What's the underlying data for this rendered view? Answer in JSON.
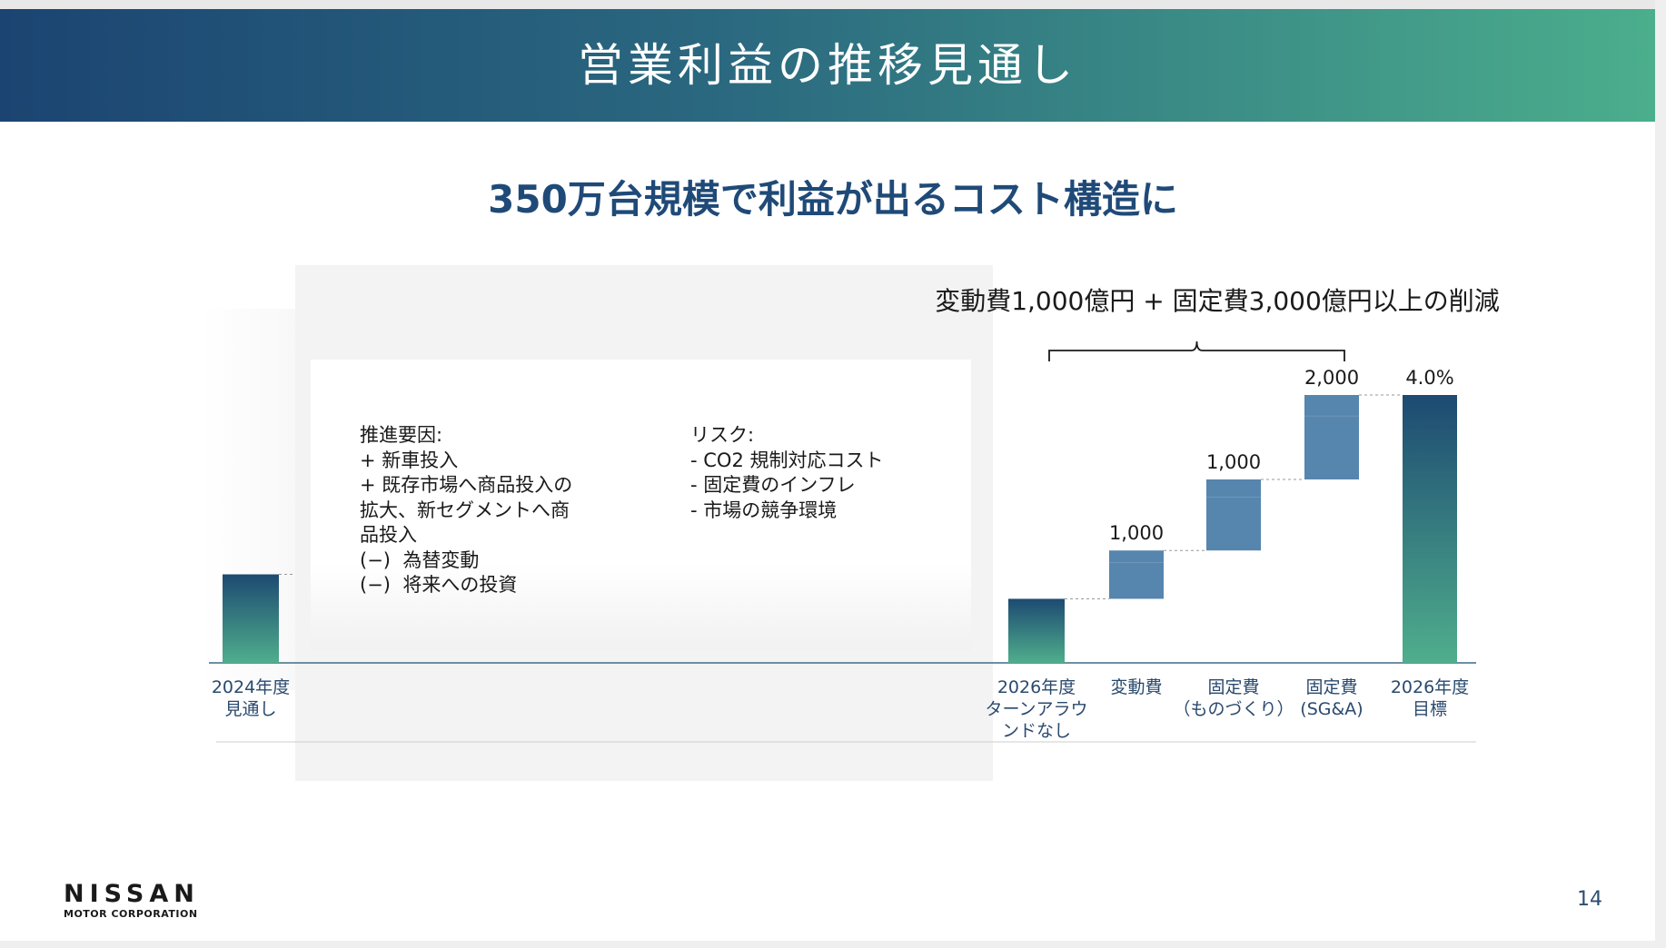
{
  "header": {
    "title": "営業利益の推移見通し"
  },
  "subtitle": "350万台規模で利益が出るコスト構造に",
  "card": {
    "drivers": [
      "推進要因:",
      "+ 新車投入",
      "+ 既存市場へ商品投入の",
      "拡大、新セグメントへ商",
      "品投入",
      "(−)  為替変動",
      "(−)  将来への投資"
    ],
    "risks": [
      "リスク:",
      "- CO2 規制対応コスト",
      "- 固定費のインフレ",
      "- 市場の競争環境"
    ]
  },
  "brace_label": "変動費1,000億円 + 固定費3,000億円以上の削減",
  "page_number": "14",
  "logo": {
    "main": "NISSAN",
    "sub": "MOTOR CORPORATION"
  },
  "colors": {
    "banner_start": "#1b4472",
    "banner_end": "#4bae8c",
    "subtitle": "#1f4a78",
    "bar_dark": "#1d4a72",
    "bar_green": "#4fae8c",
    "step_blue": "#5685ae"
  },
  "chart_data": {
    "type": "bar",
    "subtype": "waterfall",
    "categories": [
      [
        "2024年度",
        "見通し"
      ],
      [
        "2026年度",
        "ターンアラウ",
        "ンドなし"
      ],
      [
        "変動費"
      ],
      [
        "固定費",
        "（ものづくり）"
      ],
      [
        "固定費",
        "(SG&A)"
      ],
      [
        "2026年度",
        "目標"
      ]
    ],
    "bars": [
      {
        "kind": "total",
        "start": 0,
        "end": 1520,
        "label": ""
      },
      {
        "kind": "total",
        "start": 0,
        "end": 1100,
        "label": ""
      },
      {
        "kind": "delta",
        "start": 1100,
        "end": 1930,
        "label": "1,000"
      },
      {
        "kind": "delta",
        "start": 1930,
        "end": 3150,
        "label": "1,000"
      },
      {
        "kind": "delta",
        "start": 3150,
        "end": 4600,
        "label": "2,000"
      },
      {
        "kind": "total",
        "start": 0,
        "end": 4600,
        "label": "4.0%"
      }
    ],
    "ylim": [
      0,
      5000
    ],
    "grid": false,
    "legend": "none",
    "arrow": "2024年度見通し → 2026年度ターンアラウンドなし"
  }
}
